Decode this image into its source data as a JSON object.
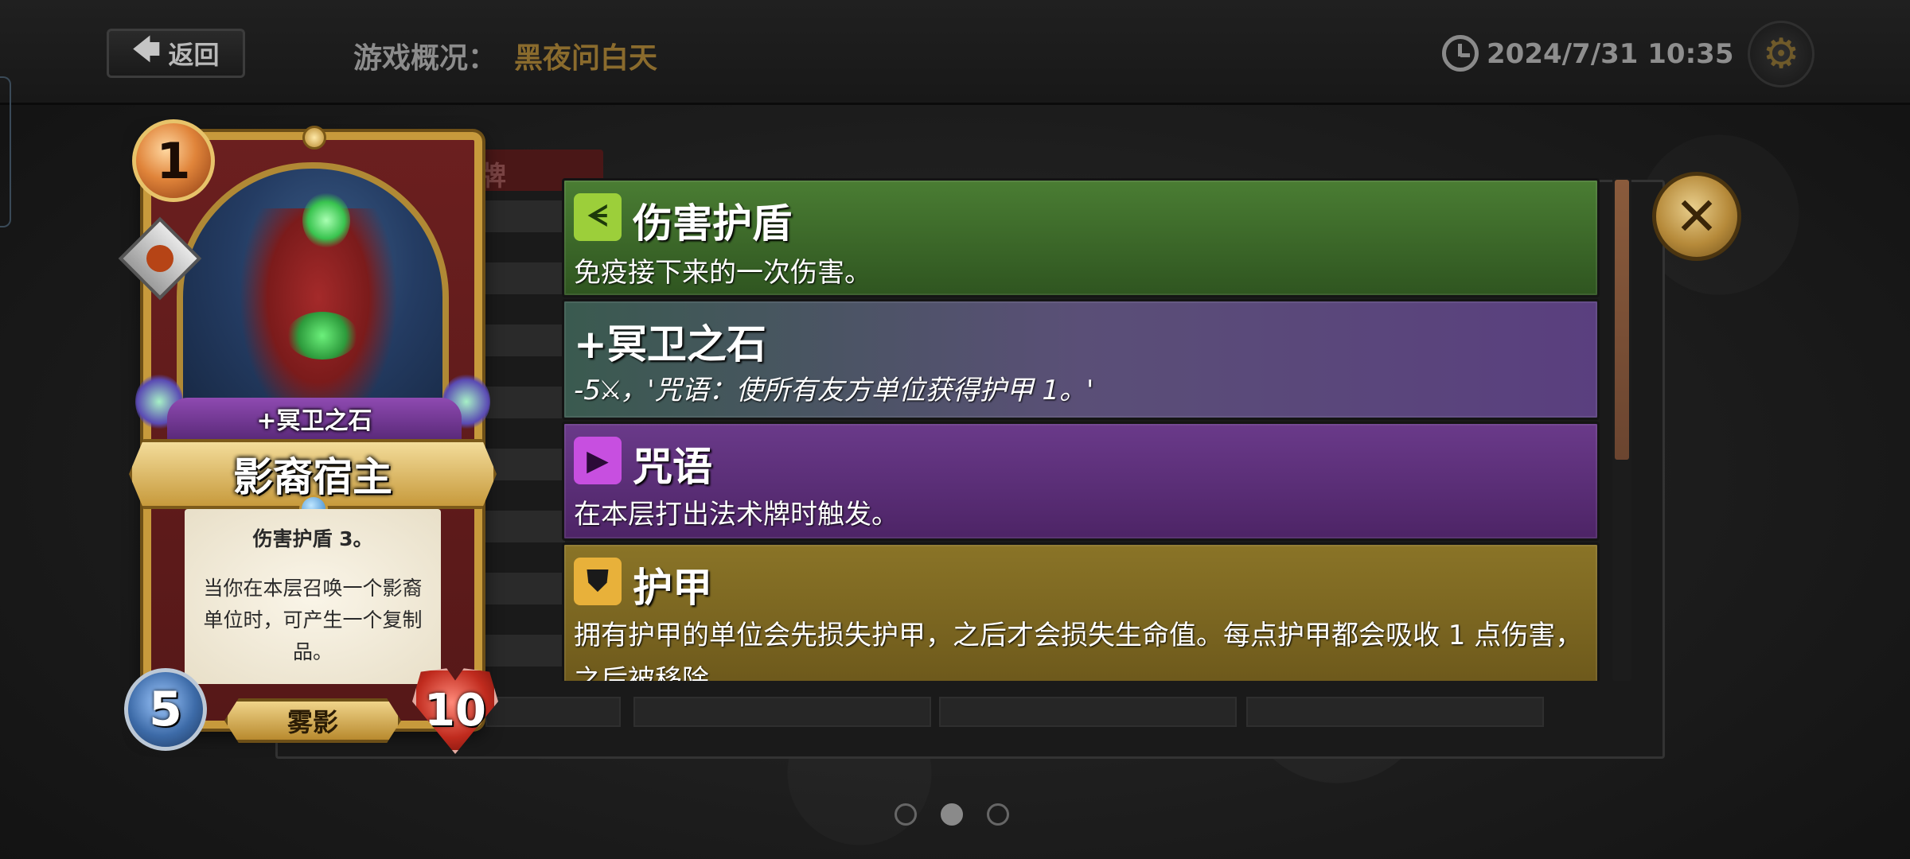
{
  "topbar": {
    "back_label": "返回",
    "back_icon": "arrow-left-icon",
    "overview_label": "游戏概况：",
    "overview_value": "黑夜问白天",
    "datetime": "2024/7/31 10:35",
    "clock_icon": "clock-icon",
    "settings_icon": "gear-icon"
  },
  "background": {
    "tab_label": "牌"
  },
  "card": {
    "cost": "1",
    "subtitle": "+冥卫之石",
    "name": "影裔宿主",
    "text_line1": "伤害护盾 3。",
    "text_line2": "当你在本层召唤一个影裔单位时，可产生一个复制品。",
    "attack": "5",
    "health": "10",
    "race": "雾影"
  },
  "keywords": [
    {
      "title": "伤害护盾",
      "description": "免疫接下来的一次伤害。",
      "icon": "damage-shield-icon",
      "color": "#3f6b2a"
    },
    {
      "title": "+冥卫之石",
      "description": "-5⚔，'咒语：使所有友方单位获得护甲 1。'",
      "icon": "",
      "color": "#4f5a6e"
    },
    {
      "title": "咒语",
      "description": "在本层打出法术牌时触发。",
      "icon": "spell-trigger-icon",
      "color": "#5a2f74"
    },
    {
      "title": "护甲",
      "description": "拥有护甲的单位会先损失护甲，之后才会损失生命值。每点护甲都会吸收 1 点伤害，之后被移除。",
      "icon": "armor-icon",
      "color": "#6e5a1c"
    }
  ],
  "close_icon": "close-icon",
  "pagination": {
    "pages": 3,
    "active": 2
  }
}
